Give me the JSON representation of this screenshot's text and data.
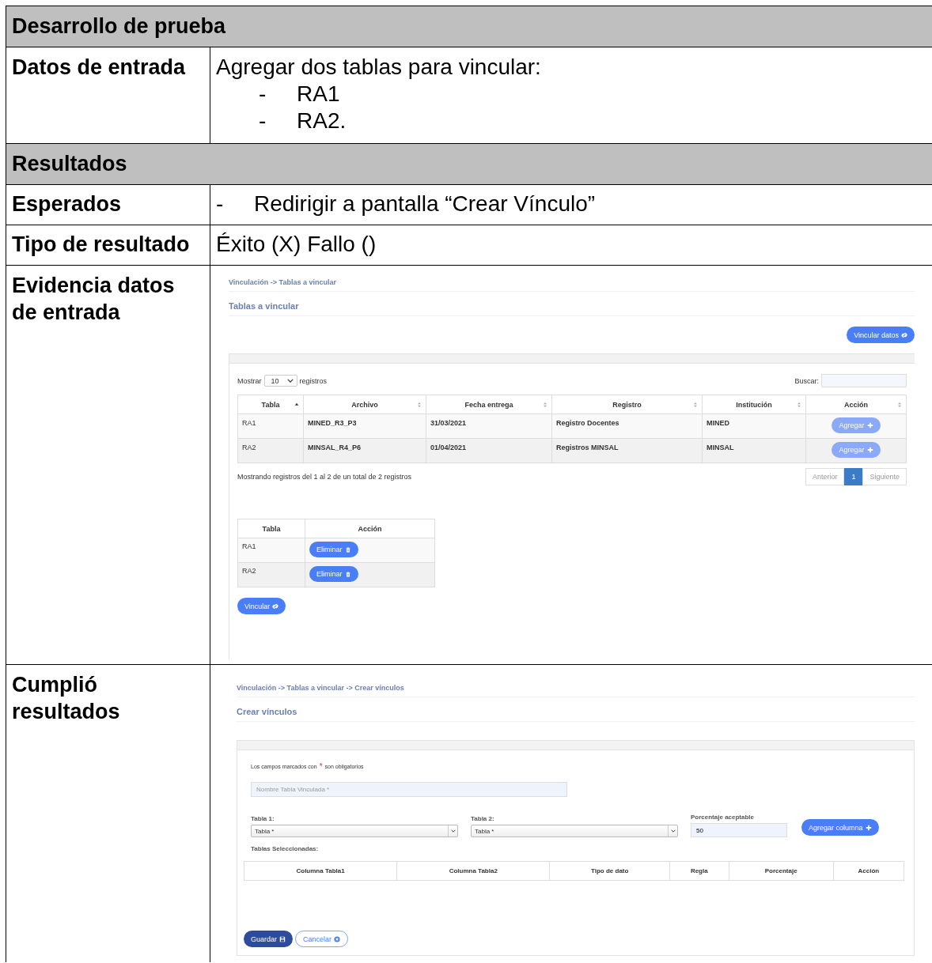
{
  "document": {
    "section_1": {
      "title": "Desarrollo de prueba"
    },
    "datos_de_entrada": {
      "label": "Datos de entrada",
      "intro": "Agregar dos tablas para vincular:",
      "items": [
        {
          "marker": "-",
          "text": "RA1"
        },
        {
          "marker": "-",
          "text": "RA2."
        }
      ]
    },
    "section_2": {
      "title": "Resultados"
    },
    "esperados": {
      "label": "Esperados",
      "items": [
        {
          "marker": "-",
          "text": "Redirigir a pantalla “Crear Vínculo”"
        }
      ]
    },
    "tipo_de_resultado": {
      "label": "Tipo de resultado",
      "value": "Éxito (X) Fallo ()"
    },
    "evidencia": {
      "label": "Evidencia datos de entrada",
      "screen": {
        "breadcrumb": "Vinculación -> Tablas a vincular",
        "title": "Tablas a vincular",
        "top_button": {
          "label": "Vincular datos"
        },
        "length": {
          "label": "Mostrar",
          "value": "10",
          "suffix": "registros"
        },
        "search": {
          "label": "Buscar:"
        },
        "table": {
          "columns": [
            {
              "label": "Tabla",
              "sorted": true
            },
            {
              "label": "Archivo",
              "sorted": false
            },
            {
              "label": "Fecha entrega",
              "sorted": false
            },
            {
              "label": "Registro",
              "sorted": false
            },
            {
              "label": "Institución",
              "sorted": false
            },
            {
              "label": "Acción",
              "sorted": false
            }
          ],
          "rows": [
            {
              "cells": [
                "RA1",
                "MINED_R3_P3",
                "31/03/2021",
                "Registro Docentes",
                "MINED"
              ],
              "action": {
                "label": "Agregar",
                "disabled": true
              }
            },
            {
              "cells": [
                "RA2",
                "MINSAL_R4_P6",
                "01/04/2021",
                "Registros MINSAL",
                "MINSAL"
              ],
              "action": {
                "label": "Agregar",
                "disabled": true
              }
            }
          ]
        },
        "info": "Mostrando registros del 1 al 2 de un total de 2 registros",
        "pagination": [
          {
            "label": "Anterior",
            "selected": false
          },
          {
            "label": "1",
            "selected": true
          },
          {
            "label": "Siguiente",
            "selected": false
          }
        ],
        "selected_table": {
          "columns": [
            "Tabla",
            "Acción"
          ],
          "rows": [
            {
              "cell": "RA1",
              "action": {
                "label": "Eliminar"
              }
            },
            {
              "cell": "RA2",
              "action": {
                "label": "Eliminar"
              }
            }
          ]
        },
        "bottom_button": {
          "label": "Vincular"
        }
      }
    },
    "cumplio": {
      "label": "Cumplió resultados",
      "screen": {
        "breadcrumb": "Vinculación -> Tablas a vincular -> Crear vínculos",
        "title": "Crear vínculos",
        "note": {
          "before": "Los campos marcados con",
          "mark": "*",
          "after": "son obligatorios"
        },
        "name_field": {
          "placeholder": "Nombre Tabla Vinculada *"
        },
        "table_1": {
          "label": "Tabla 1:",
          "value": "Tabla *"
        },
        "table_2": {
          "label": "Tabla 2:",
          "value": "Tabla *"
        },
        "percentage": {
          "label": "Porcentaje aceptable",
          "value": "50"
        },
        "add_button": {
          "label": "Agregar columna"
        },
        "selected_label": "Tablas Seleccionadas:",
        "columns": [
          "Columna Tabla1",
          "Columna Tabla2",
          "Tipo de dato",
          "Regla",
          "Porcentaje",
          "Acción"
        ],
        "buttons": [
          {
            "label": "Guardar",
            "kind": "primary"
          },
          {
            "label": "Cancelar",
            "kind": "outline"
          }
        ]
      }
    }
  }
}
